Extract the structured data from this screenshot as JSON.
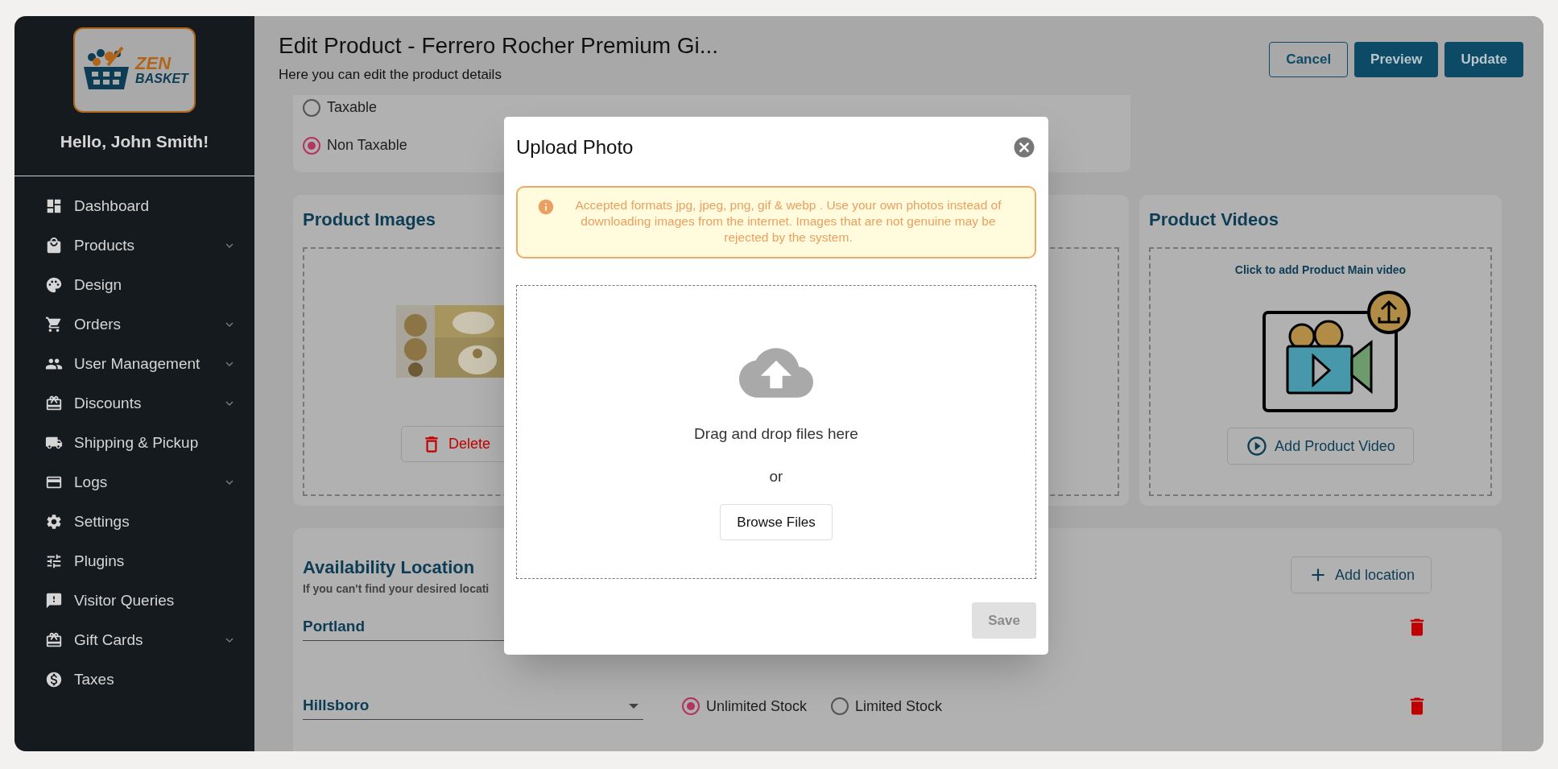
{
  "sidebar": {
    "logo": {
      "line_1": "ZEN",
      "line_2": "BASKET"
    },
    "greeting": "Hello, John Smith!",
    "items": [
      {
        "label": "Dashboard",
        "expandable": false
      },
      {
        "label": "Products",
        "expandable": true
      },
      {
        "label": "Design",
        "expandable": false
      },
      {
        "label": "Orders",
        "expandable": true
      },
      {
        "label": "User Management",
        "expandable": true
      },
      {
        "label": "Discounts",
        "expandable": true
      },
      {
        "label": "Shipping & Pickup",
        "expandable": false
      },
      {
        "label": "Logs",
        "expandable": true
      },
      {
        "label": "Settings",
        "expandable": false
      },
      {
        "label": "Plugins",
        "expandable": false
      },
      {
        "label": "Visitor Queries",
        "expandable": false
      },
      {
        "label": "Gift Cards",
        "expandable": true
      },
      {
        "label": "Taxes",
        "expandable": false
      }
    ]
  },
  "header": {
    "title": "Edit Product - Ferrero Rocher Premium Gi...",
    "subtitle": "Here you can edit the product details",
    "buttons": [
      {
        "label": "Cancel",
        "kind": "outline"
      },
      {
        "label": "Preview",
        "kind": "filled"
      },
      {
        "label": "Update",
        "kind": "filled"
      }
    ]
  },
  "tax_options": [
    {
      "label": "Taxable",
      "selected": false
    },
    {
      "label": "Non Taxable",
      "selected": true
    }
  ],
  "product_images": {
    "title": "Product Images",
    "delete_button": "Delete"
  },
  "product_videos": {
    "title": "Product Videos",
    "hint": "Click to add Product Main video",
    "button": "Add Product Video"
  },
  "availability": {
    "title": "Availability Location",
    "subtitle": "If you can't find your desired locati",
    "add_button": "Add location",
    "locations": [
      {
        "name": "Portland"
      },
      {
        "name": "Hillsboro",
        "options": [
          {
            "label": "Unlimited Stock",
            "selected": true
          },
          {
            "label": "Limited Stock",
            "selected": false
          }
        ]
      }
    ]
  },
  "modal": {
    "title": "Upload Photo",
    "notice": "Accepted formats jpg, jpeg, png, gif & webp . Use your own photos instead of downloading images from the internet. Images that are not genuine may be rejected by the system.",
    "drop_text": "Drag and drop files here",
    "or_text": "or",
    "browse_button": "Browse Files",
    "save_button": {
      "label": "Save",
      "disabled": true
    }
  }
}
